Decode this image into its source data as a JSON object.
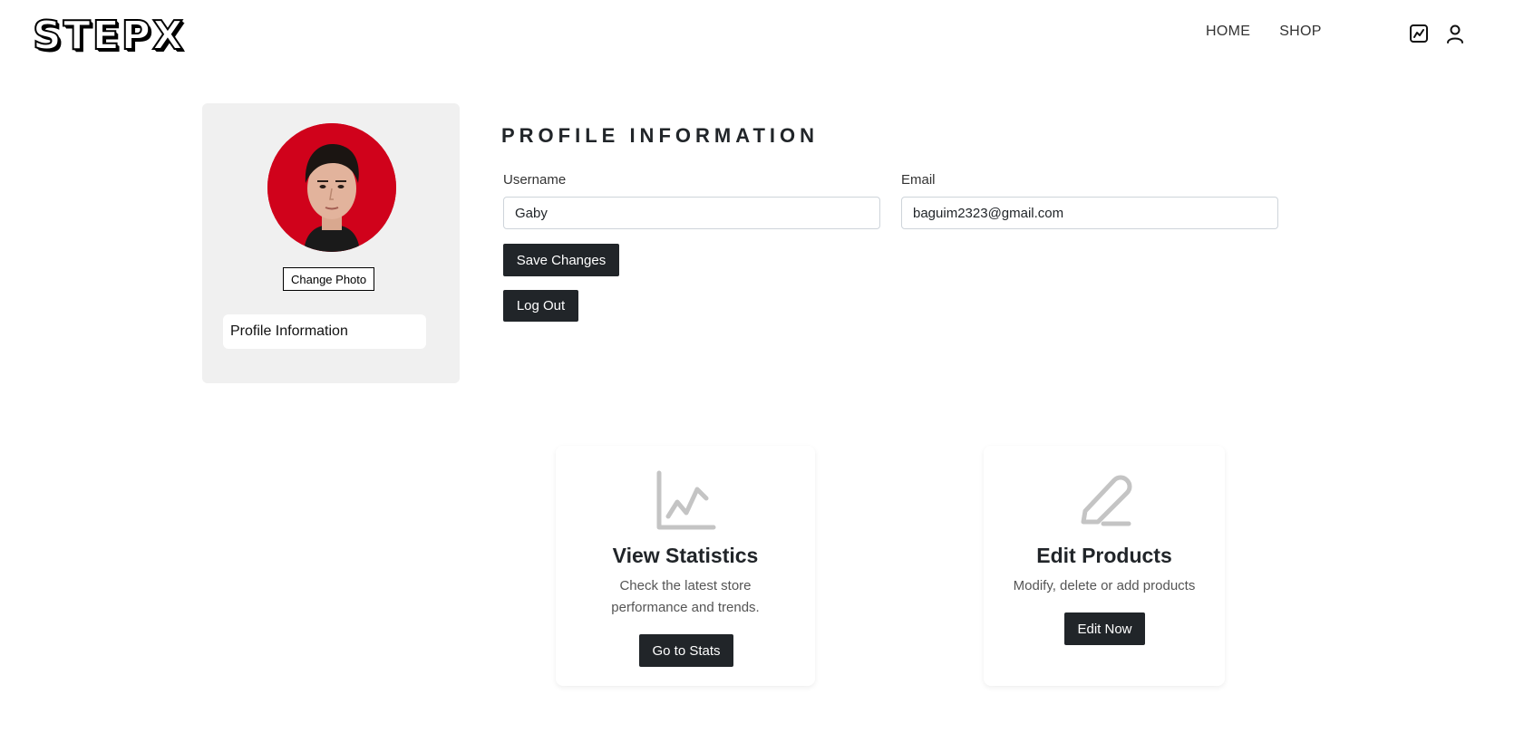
{
  "header": {
    "logo": "STEPX",
    "nav": [
      {
        "label": "HOME"
      },
      {
        "label": "SHOP"
      }
    ],
    "icons": [
      "stats-icon",
      "user-icon"
    ]
  },
  "sidebar": {
    "change_photo_label": "Change Photo",
    "items": [
      {
        "label": "Profile Information"
      }
    ]
  },
  "profile": {
    "title": "PROFILE INFORMATION",
    "username_label": "Username",
    "username_value": "Gaby",
    "email_label": "Email",
    "email_value": "baguim2323@gmail.com",
    "save_label": "Save Changes",
    "logout_label": "Log Out"
  },
  "cards": [
    {
      "icon": "chart-icon",
      "title": "View Statistics",
      "description": "Check the latest store performance and trends.",
      "button": "Go to Stats"
    },
    {
      "icon": "pen-icon",
      "title": "Edit Products",
      "description": "Modify, delete or add products",
      "button": "Edit Now"
    }
  ],
  "colors": {
    "dark": "#212529",
    "avatar_bg": "#d0021b",
    "sidebar_bg": "#f0f0f0",
    "icon_gray": "#c4c4c4"
  }
}
